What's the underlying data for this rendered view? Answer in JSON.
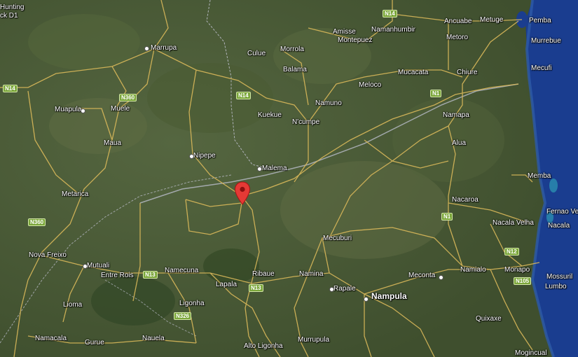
{
  "map": {
    "places": [
      {
        "id": "hunting",
        "label": "Hunting"
      },
      {
        "id": "ck-d1",
        "label": "ck D1"
      },
      {
        "id": "marrupa",
        "label": "Marrupa"
      },
      {
        "id": "muapula",
        "label": "Muapula"
      },
      {
        "id": "muele",
        "label": "Muele"
      },
      {
        "id": "maua",
        "label": "Maua"
      },
      {
        "id": "nipepe",
        "label": "Nipepe"
      },
      {
        "id": "metarica",
        "label": "Metarica"
      },
      {
        "id": "nova-freixo",
        "label": "Nova Freixo"
      },
      {
        "id": "mutuali",
        "label": "Mutuali"
      },
      {
        "id": "entre-rois",
        "label": "Entre Rois"
      },
      {
        "id": "namecuna",
        "label": "Namecuna"
      },
      {
        "id": "lapala",
        "label": "Lapala"
      },
      {
        "id": "ribaue",
        "label": "Ribaue"
      },
      {
        "id": "liomа",
        "label": "Lioma"
      },
      {
        "id": "ligonha",
        "label": "Ligonha"
      },
      {
        "id": "namacala",
        "label": "Namacala"
      },
      {
        "id": "gurue",
        "label": "Gurue"
      },
      {
        "id": "nauela",
        "label": "Nauela"
      },
      {
        "id": "alto-ligonha",
        "label": "Alto Ligonha"
      },
      {
        "id": "murrupula",
        "label": "Murrupula"
      },
      {
        "id": "rapale",
        "label": "Rapale"
      },
      {
        "id": "nampula",
        "label": "Nampula",
        "major": true
      },
      {
        "id": "namina",
        "label": "Namina"
      },
      {
        "id": "mecuburi",
        "label": "Mecuburi"
      },
      {
        "id": "malema",
        "label": "Malema"
      },
      {
        "id": "kuekue",
        "label": "Kuekue"
      },
      {
        "id": "ncumpe",
        "label": "N'cumpe"
      },
      {
        "id": "namuno",
        "label": "Namuno"
      },
      {
        "id": "balama",
        "label": "Balama"
      },
      {
        "id": "culue",
        "label": "Culue"
      },
      {
        "id": "morrola",
        "label": "Morrola"
      },
      {
        "id": "amisse",
        "label": "Amisse"
      },
      {
        "id": "namanhumbir",
        "label": "Namanhumbir"
      },
      {
        "id": "montepuez",
        "label": "Montepuez"
      },
      {
        "id": "meloco",
        "label": "Meloco"
      },
      {
        "id": "mucacata",
        "label": "Mucacata"
      },
      {
        "id": "chiure",
        "label": "Chiure"
      },
      {
        "id": "ancuabe",
        "label": "Ancuabe"
      },
      {
        "id": "metoro",
        "label": "Metoro"
      },
      {
        "id": "metuge",
        "label": "Metuge"
      },
      {
        "id": "pemba",
        "label": "Pemba"
      },
      {
        "id": "murrebue",
        "label": "Murrebue"
      },
      {
        "id": "mecufi",
        "label": "Mecufi"
      },
      {
        "id": "namapa",
        "label": "Namapa"
      },
      {
        "id": "alua",
        "label": "Alua"
      },
      {
        "id": "memba",
        "label": "Memba"
      },
      {
        "id": "nacaroa",
        "label": "Nacaroa"
      },
      {
        "id": "fernao-ve",
        "label": "Fernao Ve"
      },
      {
        "id": "nacala",
        "label": "Nacala"
      },
      {
        "id": "nacala-velha",
        "label": "Nacala Velha"
      },
      {
        "id": "namialo",
        "label": "Namialo"
      },
      {
        "id": "monapo",
        "label": "Monapo"
      },
      {
        "id": "meconta",
        "label": "Meconta"
      },
      {
        "id": "mossuril",
        "label": "Mossuril"
      },
      {
        "id": "lumbo",
        "label": "Lumbo"
      },
      {
        "id": "quixaxe",
        "label": "Quixaxe"
      },
      {
        "id": "mogincual",
        "label": "Mogincual"
      }
    ],
    "shields": [
      {
        "id": "n14-a",
        "label": "N14"
      },
      {
        "id": "n14-b",
        "label": "N14"
      },
      {
        "id": "n14-c",
        "label": "N14"
      },
      {
        "id": "n360-a",
        "label": "N360"
      },
      {
        "id": "n360-b",
        "label": "N360"
      },
      {
        "id": "n1-a",
        "label": "N1"
      },
      {
        "id": "n1-b",
        "label": "N1"
      },
      {
        "id": "n13-a",
        "label": "N13"
      },
      {
        "id": "n13-b",
        "label": "N13"
      },
      {
        "id": "n326",
        "label": "N326"
      },
      {
        "id": "n12",
        "label": "N12"
      },
      {
        "id": "n105",
        "label": "N105"
      }
    ],
    "marker": {
      "name": "location-pin-icon",
      "color": "#e53935"
    },
    "colors": {
      "land": "#4a5a36",
      "water": "#1a3d8f",
      "road": "#d9b85a",
      "border": "#c8c8d8"
    }
  }
}
